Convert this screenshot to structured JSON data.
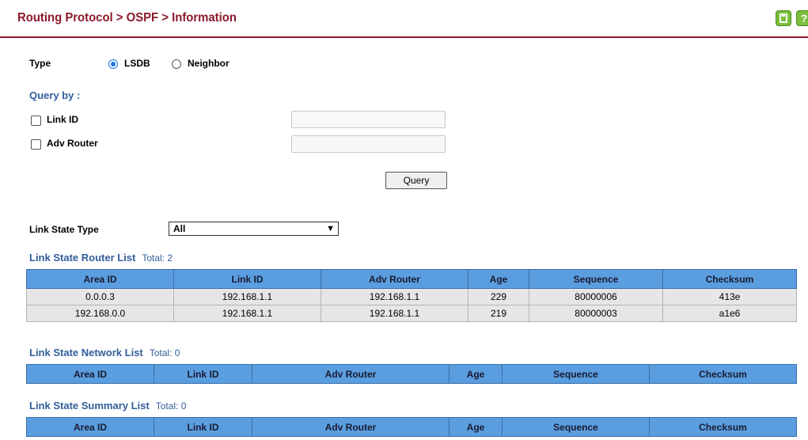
{
  "header": {
    "title": "Routing Protocol > OSPF > Information",
    "help_glyph": "?"
  },
  "type": {
    "label": "Type",
    "options": [
      "LSDB",
      "Neighbor"
    ],
    "selected": "LSDB"
  },
  "query": {
    "title": "Query by :",
    "link_id_label": "Link ID",
    "link_id_value": "",
    "adv_router_label": "Adv Router",
    "adv_router_value": "",
    "button_label": "Query"
  },
  "link_state_type": {
    "label": "Link State Type",
    "value": "All"
  },
  "router_list": {
    "title": "Link State Router List",
    "total": "Total: 2",
    "columns": [
      "Area ID",
      "Link ID",
      "Adv Router",
      "Age",
      "Sequence",
      "Checksum"
    ],
    "rows": [
      [
        "0.0.0.3",
        "192.168.1.1",
        "192.168.1.1",
        "229",
        "80000006",
        "413e"
      ],
      [
        "192.168.0.0",
        "192.168.1.1",
        "192.168.1.1",
        "219",
        "80000003",
        "a1e6"
      ]
    ]
  },
  "network_list": {
    "title": "Link State Network List",
    "total": "Total: 0",
    "columns": [
      "Area ID",
      "Link ID",
      "Adv Router",
      "Age",
      "Sequence",
      "Checksum"
    ]
  },
  "summary_list": {
    "title": "Link State Summary List",
    "total": "Total: 0",
    "columns": [
      "Area ID",
      "Link ID",
      "Adv Router",
      "Age",
      "Sequence",
      "Checksum"
    ]
  },
  "colors": {
    "header_title": "#8b1a2b",
    "section_title": "#325e9b",
    "table_header_bg": "#5a9ee0",
    "table_row_bg": "#e6e6e6",
    "icon_green": "#7bbf3a",
    "radio_accent": "#1a73e8"
  }
}
